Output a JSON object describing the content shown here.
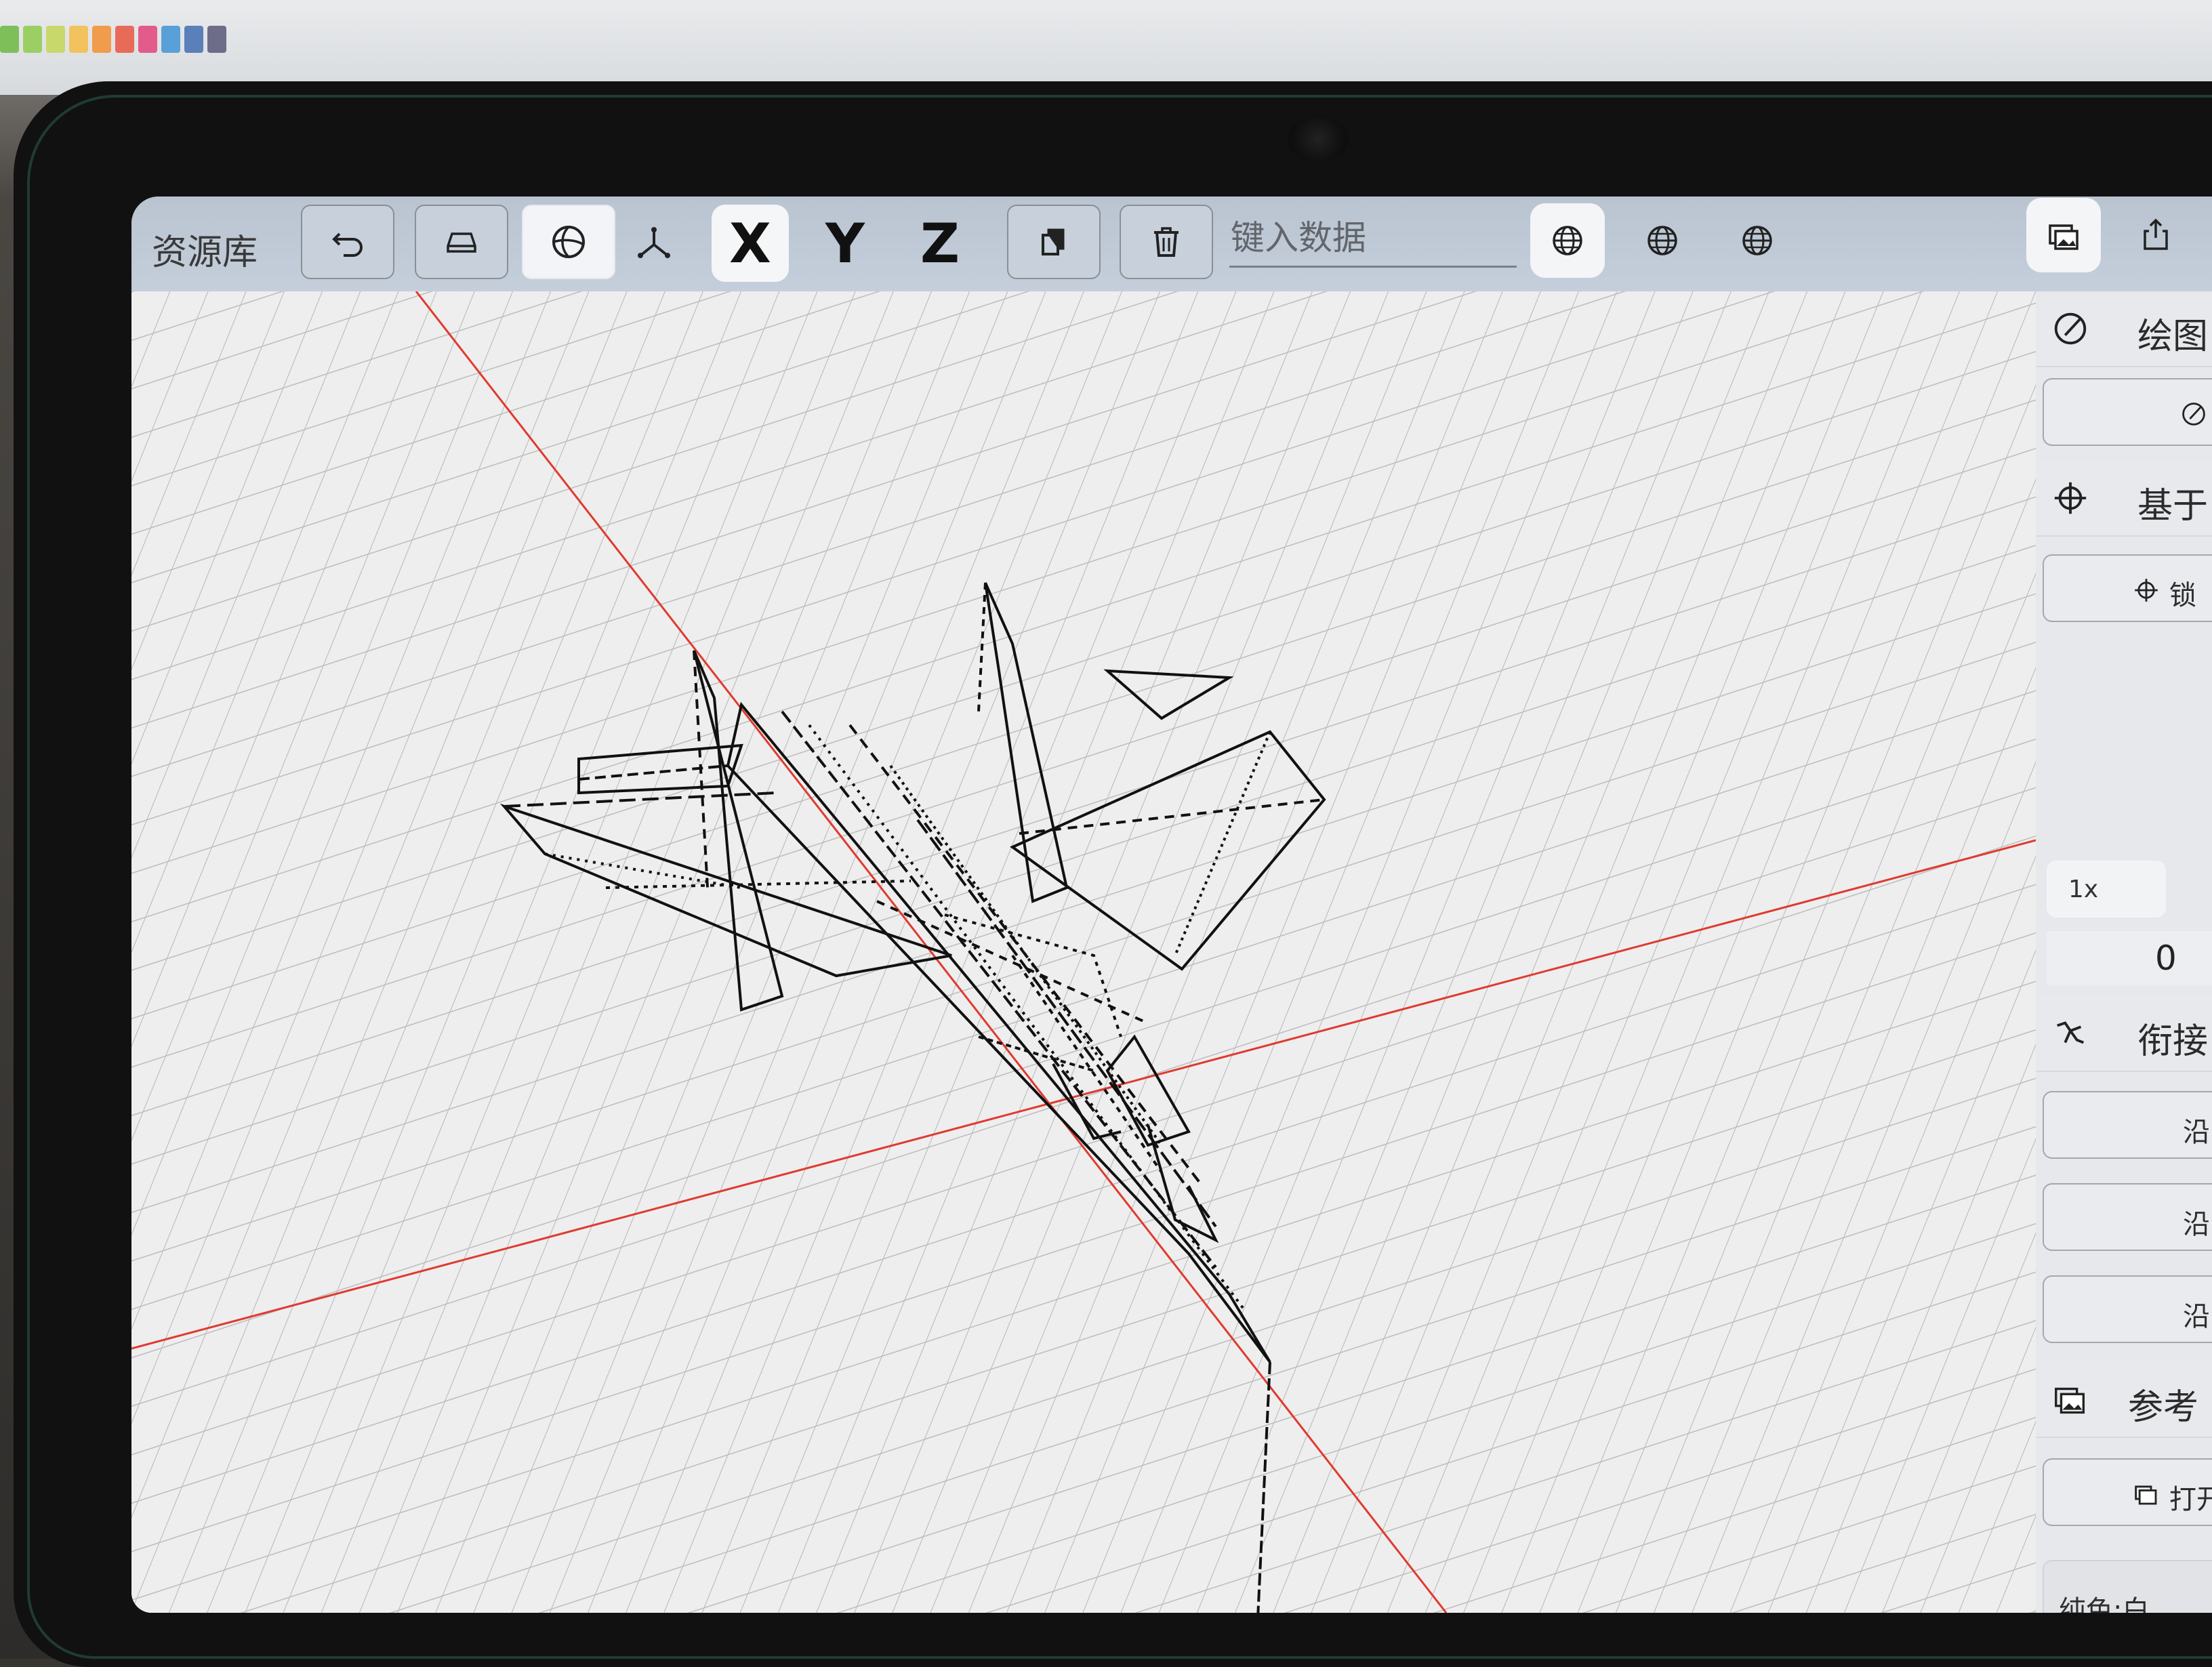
{
  "toolbar": {
    "library_label": "资源库",
    "axis_x": "X",
    "axis_y": "Y",
    "axis_z": "Z",
    "data_placeholder": "键入数据",
    "tools": [
      "undo-icon",
      "eraser-icon",
      "sphere-icon",
      "axes-icon",
      "copy-icon",
      "trash-icon"
    ],
    "globe_buttons": [
      "globe-icon",
      "globe-icon",
      "globe-icon"
    ]
  },
  "panel": {
    "draw_title": "绘图",
    "base_title": "基于",
    "lock_label": "锁",
    "zoom_label": "1x",
    "zero_value": "0",
    "connect_title": "衔接",
    "along_buttons": [
      "沿",
      "沿",
      "沿"
    ],
    "reference_title": "参考",
    "open_label": "打开",
    "color_label": "纯色:白"
  },
  "colors": {
    "toolbar_bg": "#c1cbd7",
    "grid_line": "#bdbdbd",
    "axis_line": "#e03a2f",
    "model_stroke": "#111111",
    "canvas_bg": "#eeeeee"
  }
}
